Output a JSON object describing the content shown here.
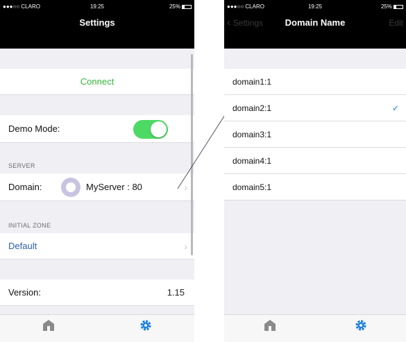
{
  "colors": {
    "accent": "#1a7fe0",
    "connect_green": "#35b43b",
    "toggle_on": "#4cd964",
    "link_blue": "#2a5fa8"
  },
  "status_bar": {
    "carrier": "●●●○○ CLARO",
    "time": "19:25",
    "battery": "25%"
  },
  "settings": {
    "title": "Settings",
    "connect_label": "Connect",
    "demo_mode_label": "Demo Mode:",
    "demo_mode_on": true,
    "server_header": "SERVER",
    "domain_label": "Domain:",
    "domain_value": "MyServer : 80",
    "initial_zone_header": "INITIAL ZONE",
    "initial_zone_value": "Default",
    "version_label": "Version:",
    "version_value": "1.15"
  },
  "domain_picker": {
    "title": "Domain Name",
    "back_label": "Settings",
    "edit_label": "Edit",
    "selected": "domain2:1",
    "domains": [
      "domain1:1",
      "domain2:1",
      "domain3:1",
      "domain4:1",
      "domain5:1"
    ]
  },
  "tabbar": {
    "tabs": [
      {
        "icon": "home-icon"
      },
      {
        "icon": "gear-icon"
      }
    ]
  }
}
